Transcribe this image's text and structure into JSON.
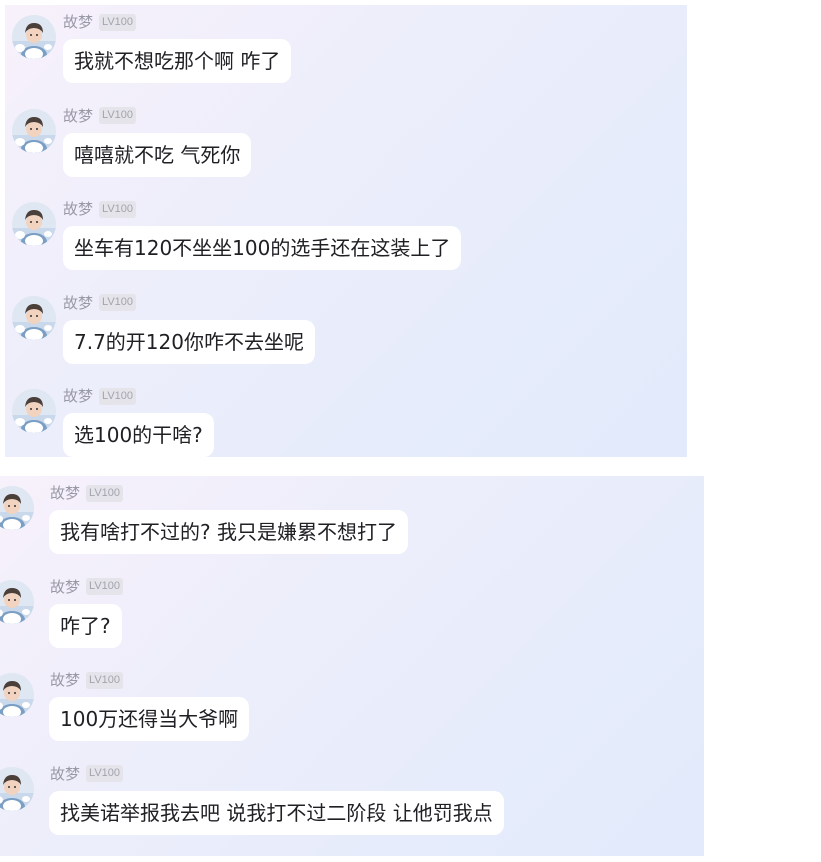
{
  "colors": {
    "bubble_bg": "#ffffff",
    "panel_gradient_start": "#f7f1fb",
    "panel_gradient_end": "#e2eafb",
    "name_text": "#9a9aa6",
    "level_badge_bg": "#e4e4ea"
  },
  "panels": [
    {
      "messages": [
        {
          "sender": "故梦",
          "level": "LV100",
          "avatar_icon": "user-avatar-icon",
          "text": "我就不想吃那个啊 咋了"
        },
        {
          "sender": "故梦",
          "level": "LV100",
          "avatar_icon": "user-avatar-icon",
          "text": "嘻嘻就不吃 气死你"
        },
        {
          "sender": "故梦",
          "level": "LV100",
          "avatar_icon": "user-avatar-icon",
          "text": "坐车有120不坐坐100的选手还在这装上了"
        },
        {
          "sender": "故梦",
          "level": "LV100",
          "avatar_icon": "user-avatar-icon",
          "text": "7.7的开120你咋不去坐呢"
        },
        {
          "sender": "故梦",
          "level": "LV100",
          "avatar_icon": "user-avatar-icon",
          "text": "选100的干啥?"
        }
      ]
    },
    {
      "messages": [
        {
          "sender": "故梦",
          "level": "LV100",
          "avatar_icon": "user-avatar-icon",
          "text": "我有啥打不过的?  我只是嫌累不想打了"
        },
        {
          "sender": "故梦",
          "level": "LV100",
          "avatar_icon": "user-avatar-icon",
          "text": "咋了?"
        },
        {
          "sender": "故梦",
          "level": "LV100",
          "avatar_icon": "user-avatar-icon",
          "text": "100万还得当大爷啊"
        },
        {
          "sender": "故梦",
          "level": "LV100",
          "avatar_icon": "user-avatar-icon",
          "text": "找美诺举报我去吧  说我打不过二阶段 让他罚我点"
        }
      ]
    }
  ]
}
